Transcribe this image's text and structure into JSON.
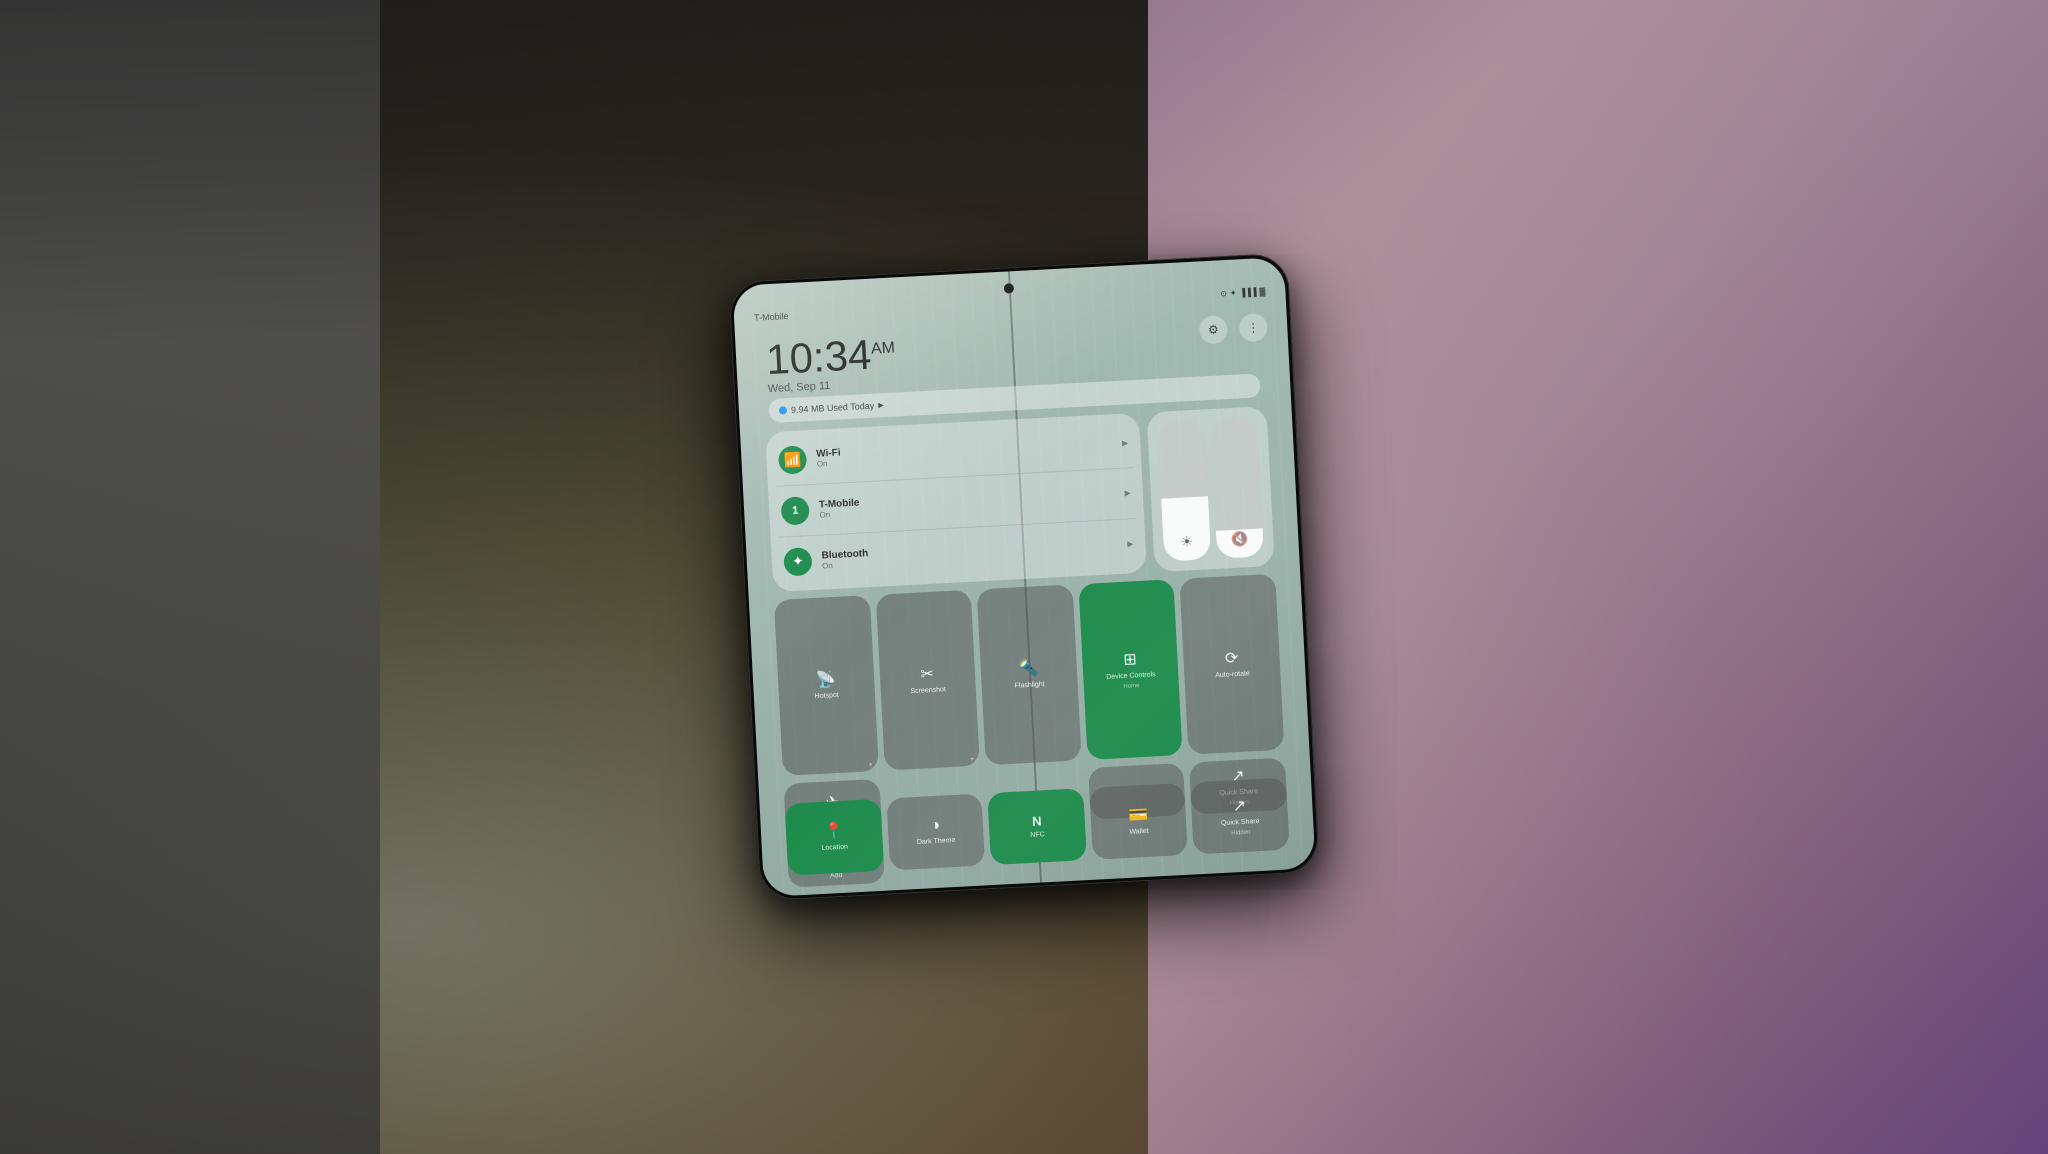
{
  "background": {
    "description": "Person holding Samsung Galaxy Z Fold phone outdoors near graffiti wall"
  },
  "phone": {
    "carrier": "T-Mobile",
    "time": "10:34",
    "time_period": "AM",
    "date": "Wed, Sep 11",
    "status_icons": [
      "wifi",
      "bluetooth",
      "signal",
      "battery"
    ],
    "data_usage": "9.94 MB Used Today"
  },
  "toggles": [
    {
      "name": "Wi-Fi",
      "status": "On",
      "icon": "📶",
      "active": true
    },
    {
      "name": "T-Mobile",
      "status": "On",
      "icon": "1️⃣",
      "active": true
    },
    {
      "name": "Bluetooth",
      "status": "On",
      "icon": "🔷",
      "active": true
    }
  ],
  "quick_tiles_row1": [
    {
      "id": "hotspot",
      "label": "Hotspot",
      "sublabel": "▾",
      "icon": "📡",
      "active": false
    },
    {
      "id": "screenshot",
      "label": "Screenshot",
      "sublabel": "▾",
      "icon": "✂",
      "active": false
    },
    {
      "id": "flashlight",
      "label": "Flashlight",
      "sublabel": "",
      "icon": "🔦",
      "active": false
    },
    {
      "id": "device-controls",
      "label": "Device Controls",
      "sublabel": "Home",
      "icon": "⊞",
      "active": true
    },
    {
      "id": "auto-rotate",
      "label": "Auto-rotate",
      "sublabel": "",
      "icon": "⟳",
      "active": false
    }
  ],
  "quick_tiles_row1_extra": [
    {
      "id": "airplane-mode",
      "label": "Airplane Mode",
      "sublabel": "",
      "icon": "✈",
      "active": false
    }
  ],
  "quick_tiles_row2": [
    {
      "id": "add",
      "label": "Add",
      "icon": "+",
      "active": false
    }
  ],
  "quick_tiles_row3": [
    {
      "id": "location",
      "label": "Location",
      "sublabel": "",
      "icon": "📍",
      "active": true
    },
    {
      "id": "dark-theme",
      "label": "Dark Theme",
      "sublabel": "",
      "icon": "◑",
      "active": false
    },
    {
      "id": "nfc",
      "label": "NFC",
      "sublabel": "",
      "icon": "N",
      "active": true
    },
    {
      "id": "wallet",
      "label": "Wallet",
      "sublabel": "",
      "icon": "💳",
      "active": false
    },
    {
      "id": "quick-share",
      "label": "Quick Share",
      "sublabel": "Hidden",
      "icon": "⟳",
      "active": false
    }
  ]
}
